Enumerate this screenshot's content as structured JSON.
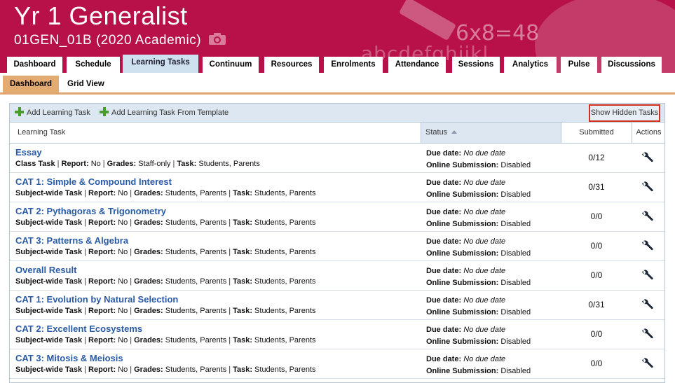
{
  "header": {
    "title": "Yr 1 Generalist",
    "subtitle": "01GEN_01B (2020 Academic)",
    "decor_text_1": "6x8=48",
    "decor_text_2": "abcdefghijkl"
  },
  "nav_tabs": [
    {
      "label": "Dashboard",
      "active": false
    },
    {
      "label": "Schedule",
      "active": false
    },
    {
      "label": "Learning Tasks",
      "active": true
    },
    {
      "label": "Continuum",
      "active": false
    },
    {
      "label": "Resources",
      "active": false
    },
    {
      "label": "Enrolments",
      "active": false
    },
    {
      "label": "Attendance",
      "active": false
    },
    {
      "label": "Sessions",
      "active": false
    },
    {
      "label": "Analytics",
      "active": false
    },
    {
      "label": "Pulse",
      "active": false
    },
    {
      "label": "Discussions",
      "active": false
    }
  ],
  "sub_tabs": {
    "dashboard": "Dashboard",
    "grid_view": "Grid View"
  },
  "toolbar": {
    "add_task": "Add Learning Task",
    "add_from_template": "Add Learning Task From Template",
    "show_hidden": "Show Hidden Tasks"
  },
  "columns": {
    "task": "Learning Task",
    "status": "Status",
    "submitted": "Submitted",
    "actions": "Actions"
  },
  "labels": {
    "report": "Report:",
    "grades": "Grades:",
    "task": "Task:",
    "due_date": "Due date:",
    "online_submission": "Online Submission:"
  },
  "tasks": [
    {
      "title": "Essay",
      "type": "Class Task",
      "report": "No",
      "grades": "Staff-only",
      "task": "Students, Parents",
      "due": "No due date",
      "online": "Disabled",
      "submitted": "0/12"
    },
    {
      "title": "CAT 1: Simple & Compound Interest",
      "type": "Subject-wide Task",
      "report": "No",
      "grades": "Students, Parents",
      "task": "Students, Parents",
      "due": "No due date",
      "online": "Disabled",
      "submitted": "0/31"
    },
    {
      "title": "CAT 2: Pythagoras & Trigonometry",
      "type": "Subject-wide Task",
      "report": "No",
      "grades": "Students, Parents",
      "task": "Students, Parents",
      "due": "No due date",
      "online": "Disabled",
      "submitted": "0/0"
    },
    {
      "title": "CAT 3: Patterns & Algebra",
      "type": "Subject-wide Task",
      "report": "No",
      "grades": "Students, Parents",
      "task": "Students, Parents",
      "due": "No due date",
      "online": "Disabled",
      "submitted": "0/0"
    },
    {
      "title": "Overall Result",
      "type": "Subject-wide Task",
      "report": "No",
      "grades": "Students, Parents",
      "task": "Students, Parents",
      "due": "No due date",
      "online": "Disabled",
      "submitted": "0/0"
    },
    {
      "title": "CAT 1: Evolution by Natural Selection",
      "type": "Subject-wide Task",
      "report": "No",
      "grades": "Students, Parents",
      "task": "Students, Parents",
      "due": "No due date",
      "online": "Disabled",
      "submitted": "0/31"
    },
    {
      "title": "CAT 2: Excellent Ecosystems",
      "type": "Subject-wide Task",
      "report": "No",
      "grades": "Students, Parents",
      "task": "Students, Parents",
      "due": "No due date",
      "online": "Disabled",
      "submitted": "0/0"
    },
    {
      "title": "CAT 3: Mitosis & Meiosis",
      "type": "Subject-wide Task",
      "report": "No",
      "grades": "Students, Parents",
      "task": "Students, Parents",
      "due": "No due date",
      "online": "Disabled",
      "submitted": "0/0"
    }
  ],
  "colors": {
    "brand": "#b8114a",
    "active_tab": "#cfe1ef",
    "subtab_active": "#e3aa72",
    "link": "#2a5ba6",
    "highlight_border": "#d0301e"
  }
}
